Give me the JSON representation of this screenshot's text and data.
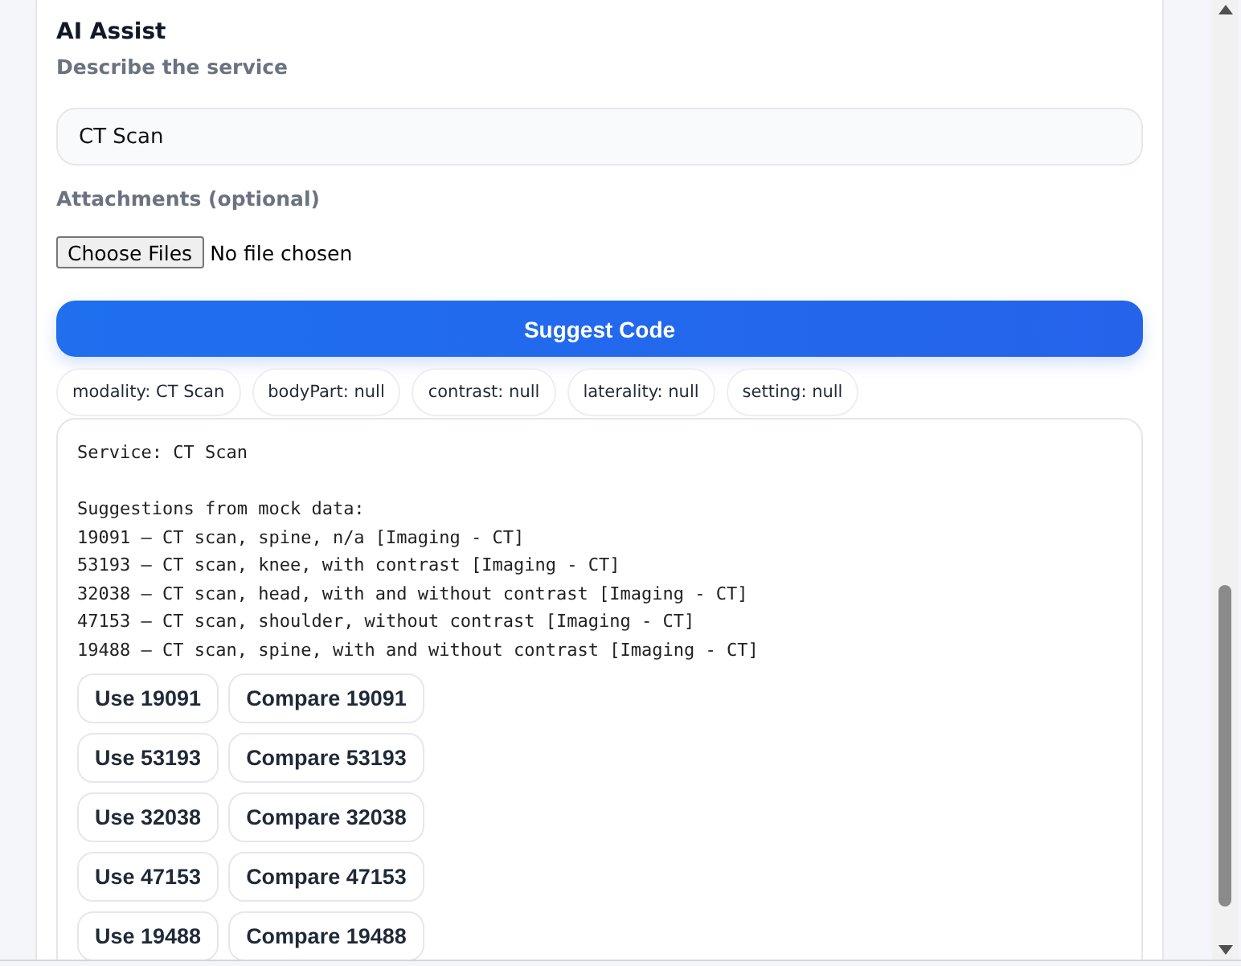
{
  "section": {
    "title": "AI Assist",
    "description_label": "Describe the service",
    "description_value": "CT Scan",
    "attachments_label": "Attachments (optional)",
    "file_button": "Choose Files",
    "file_status": "No file chosen",
    "suggest_button": "Suggest Code"
  },
  "chips": [
    "modality: CT Scan",
    "bodyPart: null",
    "contrast: null",
    "laterality: null",
    "setting: null"
  ],
  "result": {
    "service_line": "Service: CT Scan",
    "lines": [
      "Suggestions from mock data:",
      "19091 — CT scan, spine, n/a [Imaging - CT]",
      "53193 — CT scan, knee, with contrast [Imaging - CT]",
      "32038 — CT scan, head, with and without contrast [Imaging - CT]",
      "47153 — CT scan, shoulder, without contrast [Imaging - CT]",
      "19488 — CT scan, spine, with and without contrast [Imaging - CT]"
    ],
    "actions": [
      {
        "use": "Use 19091",
        "compare": "Compare 19091"
      },
      {
        "use": "Use 53193",
        "compare": "Compare 53193"
      },
      {
        "use": "Use 32038",
        "compare": "Compare 32038"
      },
      {
        "use": "Use 47153",
        "compare": "Compare 47153"
      },
      {
        "use": "Use 19488",
        "compare": "Compare 19488"
      }
    ]
  }
}
